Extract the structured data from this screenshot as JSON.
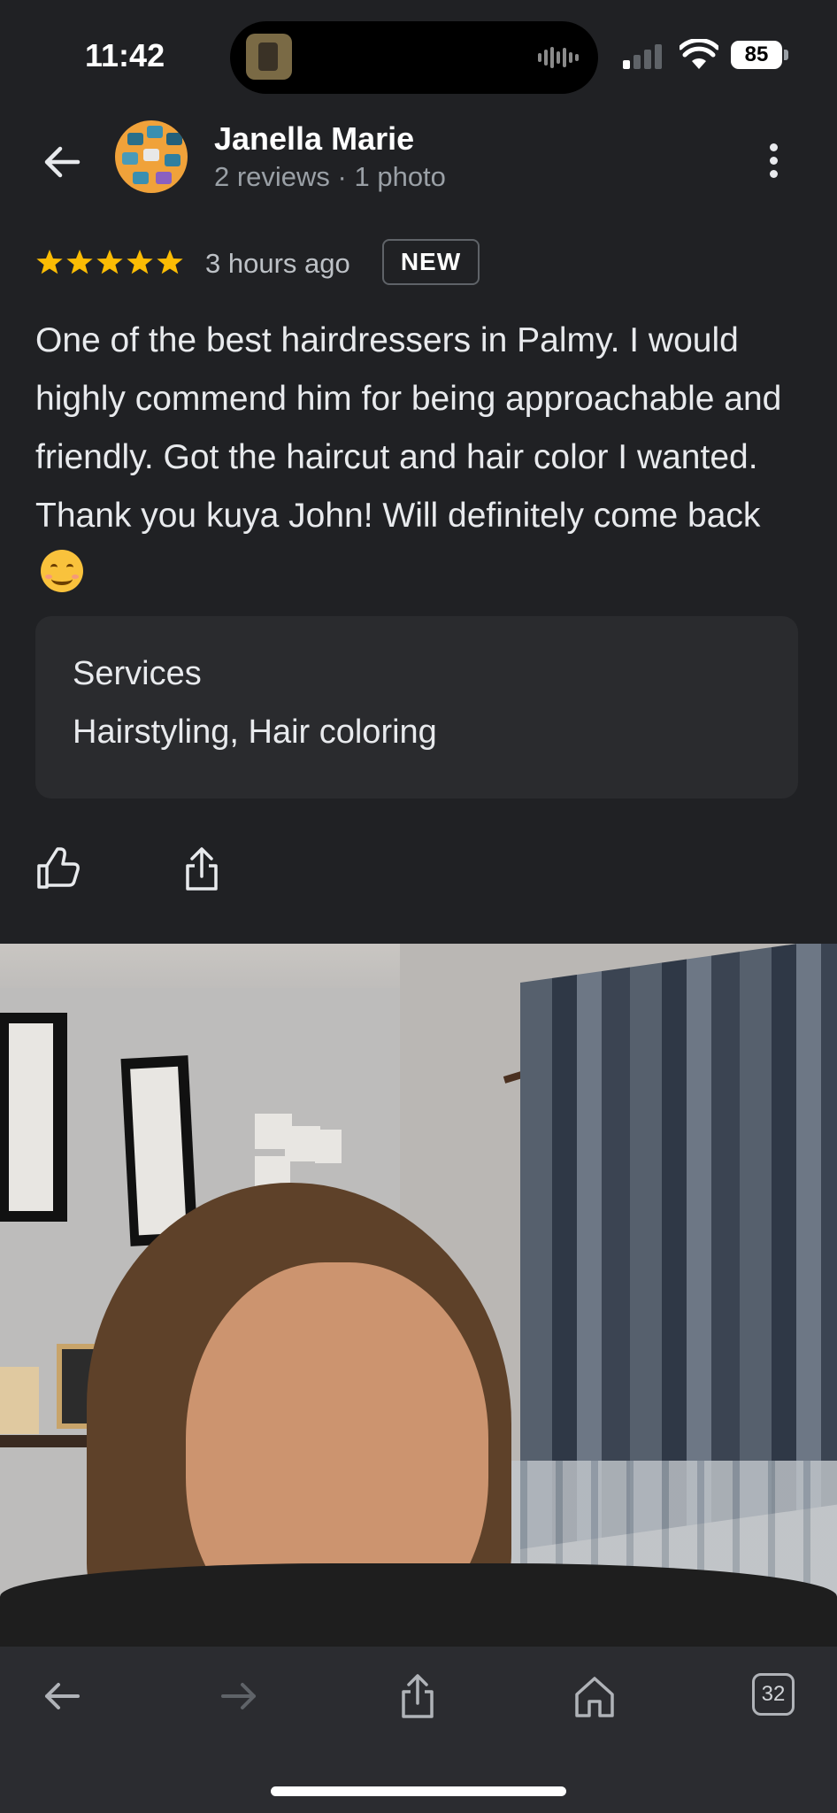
{
  "status_bar": {
    "time": "11:42",
    "battery": "85"
  },
  "reviewer": {
    "name": "Janella Marie",
    "meta": "2 reviews · 1 photo"
  },
  "review": {
    "rating": 5,
    "time_ago": "3 hours ago",
    "badge": "NEW",
    "text": "One of the best hairdressers in Palmy. I would highly commend him for being approachable and friendly. Got the haircut and hair color I wanted. Thank you kuya John! Will definitely come back"
  },
  "services": {
    "title": "Services",
    "value": "Hairstyling, Hair coloring"
  },
  "photo": {
    "count": 1
  },
  "toolbar": {
    "tab_count": "32"
  },
  "colors": {
    "star": "#fbbc04",
    "background": "#202124",
    "card": "#2a2b2e"
  },
  "icons": [
    "back-arrow-icon",
    "more-vert-icon",
    "thumbs-up-icon",
    "share-icon",
    "forward-arrow-icon",
    "home-icon",
    "tabs-icon"
  ]
}
